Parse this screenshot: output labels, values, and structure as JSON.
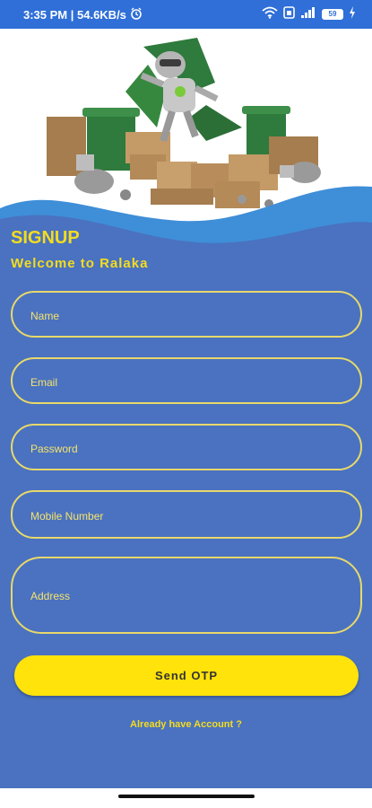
{
  "status_bar": {
    "time_speed": "3:35 PM | 54.6KB/s",
    "battery_level": "59"
  },
  "icons": [
    "alarm-icon",
    "wifi-icon",
    "sim-icon",
    "signal-icon",
    "battery-icon",
    "charging-icon"
  ],
  "form": {
    "title": "SIGNUP",
    "subtitle": "Welcome to Ralaka",
    "name_placeholder": "Name",
    "email_placeholder": "Email",
    "password_placeholder": "Password",
    "mobile_placeholder": "Mobile Number",
    "address_placeholder": "Address",
    "send_otp_label": "Send OTP",
    "login_link": "Already have Account ?"
  },
  "colors": {
    "background": "#4a72c0",
    "accent_yellow": "#ffe30a",
    "status_bar": "#2f6fd7"
  }
}
